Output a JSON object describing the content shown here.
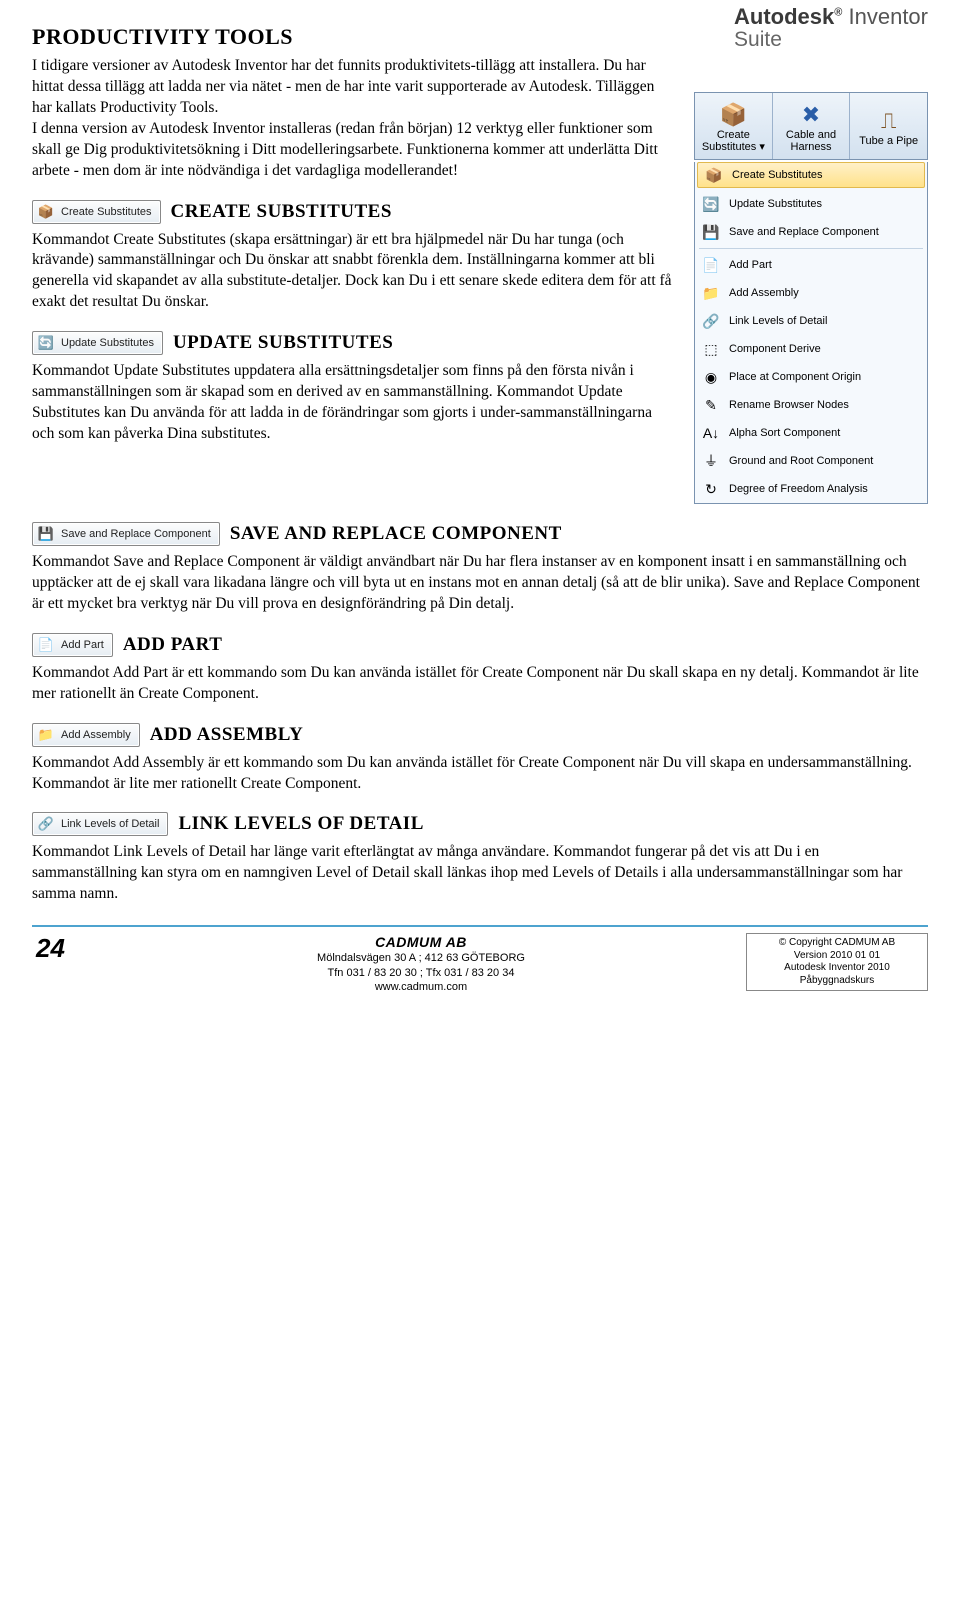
{
  "brand": {
    "line1_a": "Autodesk",
    "line1_b": "Inventor",
    "line2": "Suite"
  },
  "page_title": "PRODUCTIVITY TOOLS",
  "intro": "I tidigare versioner av Autodesk Inventor har det funnits produktivitets-tillägg att installera. Du har hittat dessa tillägg att ladda ner via nätet - men de har inte varit supporterade av Autodesk. Tilläggen har kallats Productivity Tools.\nI denna version av Autodesk Inventor installeras (redan från början) 12 verktyg eller funktioner som skall ge Dig produktivitetsökning i Ditt modelleringsarbete. Funktionerna kommer att underlätta Ditt arbete - men dom är inte nödvändiga i det vardagliga modellerandet!",
  "sections": {
    "create_sub": {
      "btn": "Create Substitutes",
      "title": "CREATE SUBSTITUTES",
      "body": "Kommandot Create Substitutes (skapa ersättningar) är ett bra hjälpmedel när Du har tunga (och krävande) sammanställningar och Du önskar att snabbt förenkla dem. Inställningarna kommer att bli generella vid skapandet av alla substitute-detaljer. Dock kan Du i ett senare skede editera dem för att få exakt det resultat Du önskar."
    },
    "update_sub": {
      "btn": "Update Substitutes",
      "title": "UPDATE SUBSTITUTES",
      "body": "Kommandot Update Substitutes uppdatera alla ersättningsdetaljer som finns på den första nivån i sammanställningen som är skapad som en derived av en sammanställning. Kommandot Update Substitutes kan Du använda för att ladda in de förändringar som gjorts i under-sammanställningarna och som kan påverka Dina substitutes."
    },
    "save_replace": {
      "btn": "Save and Replace Component",
      "title": "SAVE AND REPLACE COMPONENT",
      "body": "Kommandot Save and Replace Component är väldigt användbart när Du har flera instanser av en komponent insatt i en sammanställning och upptäcker att de ej skall vara likadana längre och vill byta ut en instans mot en annan detalj (så att de blir unika). Save and Replace Component är ett mycket bra verktyg när Du vill prova en designförändring på Din detalj."
    },
    "add_part": {
      "btn": "Add Part",
      "title": "ADD PART",
      "body": "Kommandot Add Part är ett kommando som Du kan använda istället för Create Component när Du skall skapa en ny detalj. Kommandot är lite mer rationellt än Create Component."
    },
    "add_asm": {
      "btn": "Add Assembly",
      "title": "ADD ASSEMBLY",
      "body": "Kommandot Add Assembly är ett kommando som Du kan använda istället för Create Component när Du vill skapa en undersammanställning. Kommandot är lite mer rationellt Create Component."
    },
    "link_lod": {
      "btn": "Link Levels of Detail",
      "title": "LINK LEVELS OF DETAIL",
      "body": "Kommandot Link Levels of Detail har länge varit efterlängtat av många användare. Kommandot fungerar på det vis att Du i en sammanställning kan styra om en namngiven Level of Detail skall länkas ihop med Levels of Details i alla undersammanställningar som har samma namn."
    }
  },
  "ribbon": [
    {
      "icon": "📦",
      "label": "Create Substitutes",
      "dropdown": true
    },
    {
      "icon": "✖",
      "label": "Cable and Harness"
    },
    {
      "icon": "⎍",
      "label": "Tube a Pipe"
    }
  ],
  "dropdown_items": [
    {
      "icon": "📦",
      "label": "Create Substitutes",
      "highlight": true
    },
    {
      "icon": "🔄",
      "label": "Update Substitutes"
    },
    {
      "icon": "💾",
      "label": "Save and Replace Component"
    },
    {
      "sep": true
    },
    {
      "icon": "📄",
      "label": "Add Part"
    },
    {
      "icon": "📁",
      "label": "Add Assembly"
    },
    {
      "icon": "🔗",
      "label": "Link Levels of Detail"
    },
    {
      "icon": "⬚",
      "label": "Component Derive"
    },
    {
      "icon": "◉",
      "label": "Place at Component Origin"
    },
    {
      "icon": "✎",
      "label": "Rename Browser Nodes"
    },
    {
      "icon": "A↓",
      "label": "Alpha Sort Component"
    },
    {
      "icon": "⏚",
      "label": "Ground and Root Component"
    },
    {
      "icon": "↻",
      "label": "Degree of Freedom Analysis"
    }
  ],
  "footer": {
    "page": "24",
    "company": "CADMUM AB",
    "addr1": "Mölndalsvägen 30 A ; 412 63 GÖTEBORG",
    "addr2": "Tfn 031 / 83 20 30 ; Tfx 031 / 83 20 34",
    "addr3": "www.cadmum.com",
    "box1": "©  Copyright CADMUM AB",
    "box2": "Version 2010 01 01",
    "box3": "Autodesk Inventor 2010",
    "box4": "Påbyggnadskurs"
  }
}
